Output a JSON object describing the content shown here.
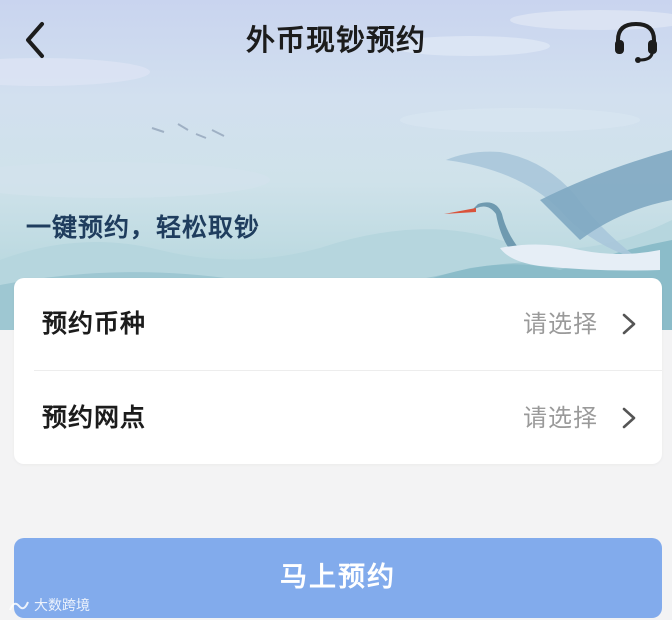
{
  "header": {
    "title": "外币现钞预约"
  },
  "hero": {
    "slogan": "一键预约，轻松取钞"
  },
  "form": {
    "rows": [
      {
        "label": "预约币种",
        "value": "请选择"
      },
      {
        "label": "预约网点",
        "value": "请选择"
      }
    ]
  },
  "actions": {
    "submit_label": "马上预约"
  },
  "watermark": {
    "text": "大数跨境"
  },
  "icons": {
    "back": "chevron-left-icon",
    "support": "headset-icon",
    "row_arrow": "chevron-right-icon"
  },
  "colors": {
    "primary_button": "#82abec",
    "slogan_text": "#1f3d5e",
    "placeholder_text": "#9a9a9a"
  }
}
